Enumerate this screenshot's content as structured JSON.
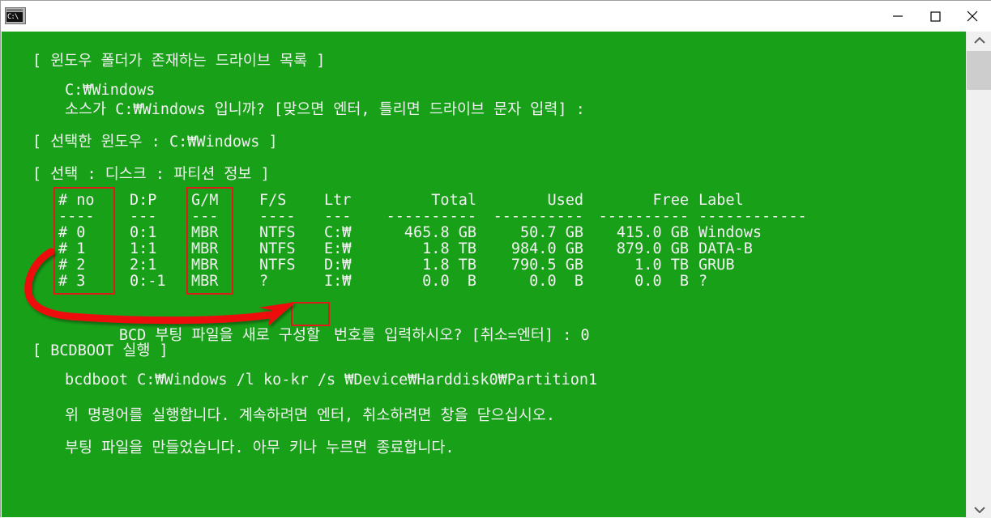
{
  "window": {
    "title": "",
    "icon": "cmd-console-icon",
    "icon_text": "C:\\",
    "bg_color": "#19A019",
    "text_color": "#f2f2f2",
    "annotation_color": "#e11b1b",
    "controls": {
      "minimize": "minimize-icon",
      "maximize": "maximize-icon",
      "close": "close-icon"
    }
  },
  "scrollbar": {
    "up_arrow": "chevron-up-icon",
    "down_arrow": "chevron-down-icon",
    "thumb": "scrollbar-thumb"
  },
  "console": {
    "lines": [
      "[ 윈도우 폴더가 존재하는 드라이브 목록 ]",
      "",
      "    C:₩Windows",
      "    소스가 C:₩Windows 입니까? [맞으면 엔터, 틀리면 드라이브 문자 입력] :",
      "",
      "[ 선택한 윈도우 : C:₩Windows ]",
      "",
      "[ 선택 : 디스크 : 파티션 정보 ]"
    ],
    "header_list": "[ 윈도우 폴더가 존재하는 드라이브 목록 ]",
    "source_path": "C:₩Windows",
    "source_prompt": "소스가 C:₩Windows 입니까? [맞으면 엔터, 틀리면 드라이브 문자 입력] :",
    "selected_windows": "[ 선택한 윈도우 : C:₩Windows ]",
    "partition_info_header": "[ 선택 : 디스크 : 파티션 정보 ]",
    "bcd_prompt_before": "BCD 부팅 파일을 새로 구성할ㅤ",
    "bcd_prompt_highlight": "번호",
    "bcd_prompt_after": "를 입력하시오? [취소=엔터] : 0",
    "bcdboot_header": "[ BCDBOOT 실행 ]",
    "bcdboot_command": "bcdboot C:₩Windows /l ko-kr /s ₩Device₩Harddisk0₩Partition1",
    "run_notice": "위 명령어를 실행합니다. 계속하려면 엔터, 취소하려면 창을 닫으십시오.",
    "done_notice": "부팅 파일을 만들었습니다. 아무 키나 누르면 종료합니다."
  },
  "table": {
    "columns": [
      {
        "key": "no",
        "label": "# no",
        "rule": "----"
      },
      {
        "key": "dp",
        "label": "D:P",
        "rule": "---"
      },
      {
        "key": "gm",
        "label": "G/M",
        "rule": "---"
      },
      {
        "key": "fs",
        "label": "F/S",
        "rule": "----"
      },
      {
        "key": "ltr",
        "label": "Ltr",
        "rule": "---"
      },
      {
        "key": "total",
        "label": "Total",
        "rule": "----------"
      },
      {
        "key": "used",
        "label": "Used",
        "rule": "----------"
      },
      {
        "key": "free",
        "label": "Free",
        "rule": "----------"
      },
      {
        "key": "label",
        "label": "Label",
        "rule": "------------"
      }
    ],
    "rows": [
      {
        "no": "# 0",
        "dp": "0:1",
        "gm": "MBR",
        "fs": "NTFS",
        "ltr": "C:₩",
        "total": "465.8 GB",
        "used": "50.7 GB",
        "free": "415.0 GB",
        "label": "Windows"
      },
      {
        "no": "# 1",
        "dp": "1:1",
        "gm": "MBR",
        "fs": "NTFS",
        "ltr": "E:₩",
        "total": "1.8 TB",
        "used": "984.0 GB",
        "free": "879.0 GB",
        "label": "DATA-B"
      },
      {
        "no": "# 2",
        "dp": "2:1",
        "gm": "MBR",
        "fs": "NTFS",
        "ltr": "D:₩",
        "total": "1.8 TB",
        "used": "790.5 GB",
        "free": "1.0 TB",
        "label": "GRUB"
      },
      {
        "no": "# 3",
        "dp": "0:-1",
        "gm": "MBR",
        "fs": "?",
        "ltr": "I:₩",
        "total": "0.0  B",
        "used": "0.0  B",
        "free": "0.0  B",
        "label": "?"
      }
    ]
  },
  "annotations": {
    "box_no_column": "highlight-box-no-column",
    "box_gm_column": "highlight-box-gm-column",
    "box_number_word": "highlight-box-number-word",
    "arrow": "red-curved-arrow"
  }
}
